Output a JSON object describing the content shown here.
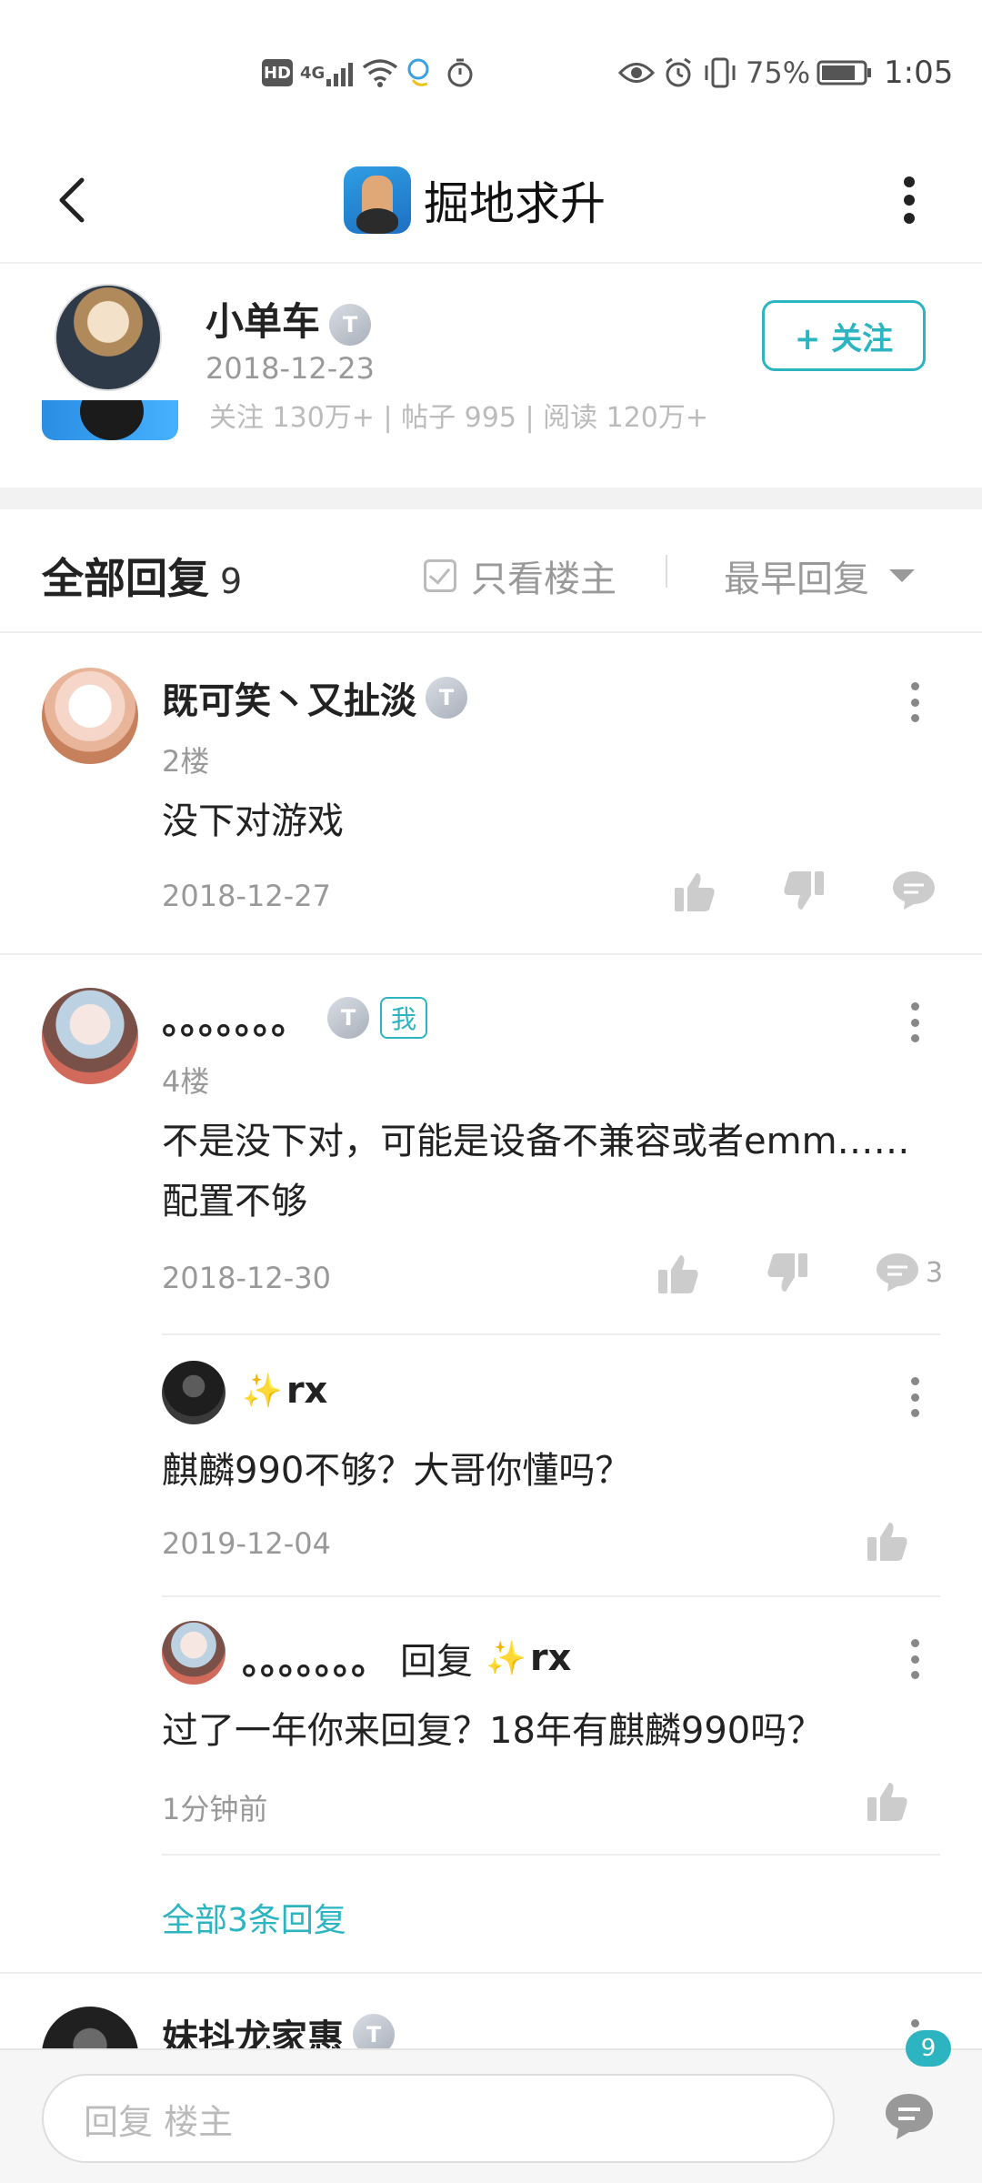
{
  "status_bar": {
    "network": "4G",
    "battery": "75%",
    "time": "1:05",
    "icons": [
      "hd-icon",
      "signal-icon",
      "wifi-icon",
      "assistant-icon",
      "timer-icon",
      "eye-icon",
      "alarm-icon",
      "vibrate-icon",
      "battery-icon"
    ]
  },
  "topbar": {
    "title": "掘地求升",
    "back_icon": "chevron-left-icon",
    "more_icon": "more-vertical-icon"
  },
  "author": {
    "name": "小单车",
    "level": "T",
    "date": "2018-12-23",
    "follow_label": "+ 关注",
    "forum_stats": "关注 130万+ | 帖子 995 | 阅读 120万+"
  },
  "replies_header": {
    "title": "全部回复",
    "count": "9",
    "only_op_label": "只看楼主",
    "sort_label": "最早回复"
  },
  "comments": [
    {
      "name": "既可笑丶又扯淡",
      "level": "T",
      "floor": "2楼",
      "text": "没下对游戏",
      "date": "2018-12-27"
    },
    {
      "name": "。。。。。。。",
      "level": "T",
      "me_label": "我",
      "floor": "4楼",
      "text_line1": "不是没下对，可能是设备不兼容或者emm……",
      "text_line2": "配置不够",
      "date": "2018-12-30",
      "reply_count": "3"
    }
  ],
  "sub_replies": [
    {
      "name": "rx",
      "text": "麒麟990不够？大哥你懂吗？",
      "date": "2019-12-04"
    },
    {
      "name": "。。。。。。。",
      "reply_word": "回复",
      "target": "rx",
      "text": "过了一年你来回复？18年有麒麟990吗？",
      "date": "1分钟前"
    }
  ],
  "all_replies_link": "全部3条回复",
  "next_comment": {
    "name": "妹抖龙家惠",
    "level": "T"
  },
  "bottom": {
    "reply_placeholder": "回复  楼主",
    "message_badge": "9"
  },
  "colors": {
    "accent": "#2cb5c1",
    "text": "#222222",
    "muted": "#999999",
    "icon_muted": "#bbbbbb"
  }
}
